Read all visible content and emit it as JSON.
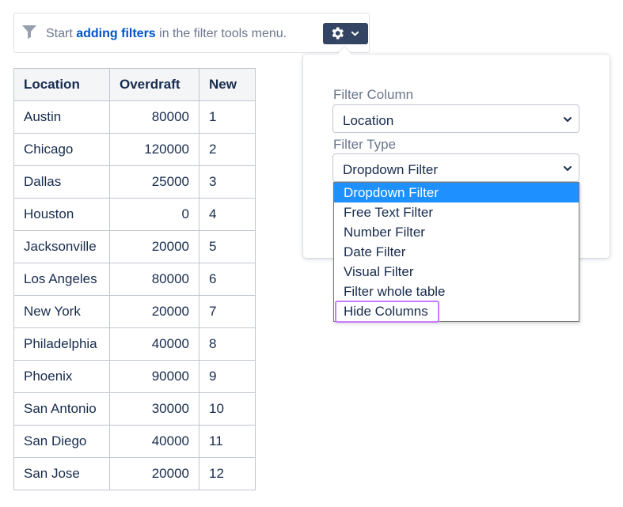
{
  "hint": {
    "prefix": "Start ",
    "link": "adding filters",
    "suffix": " in the filter tools menu.",
    "funnel_icon": "funnel-icon",
    "gear_icon": "gear-icon",
    "chevron_icon": "chevron-down-icon"
  },
  "table": {
    "headers": [
      "Location",
      "Overdraft",
      "New"
    ],
    "rows": [
      [
        "Austin",
        "80000",
        "1"
      ],
      [
        "Chicago",
        "120000",
        "2"
      ],
      [
        "Dallas",
        "25000",
        "3"
      ],
      [
        "Houston",
        "0",
        "4"
      ],
      [
        "Jacksonville",
        "20000",
        "5"
      ],
      [
        "Los Angeles",
        "80000",
        "6"
      ],
      [
        "New York",
        "20000",
        "7"
      ],
      [
        "Philadelphia",
        "40000",
        "8"
      ],
      [
        "Phoenix",
        "90000",
        "9"
      ],
      [
        "San Antonio",
        "30000",
        "10"
      ],
      [
        "San Diego",
        "40000",
        "11"
      ],
      [
        "San Jose",
        "20000",
        "12"
      ]
    ]
  },
  "panel": {
    "filter_column_label": "Filter Column",
    "filter_column_value": "Location",
    "filter_type_label": "Filter Type",
    "filter_type_value": "Dropdown Filter",
    "options": [
      "Dropdown Filter",
      "Free Text Filter",
      "Number Filter",
      "Date Filter",
      "Visual Filter",
      "Filter whole table",
      "Hide Columns"
    ],
    "selected_index": 0,
    "highlighted_option": "Hide Columns"
  },
  "colors": {
    "accent": "#0052cc",
    "gear_button": "#344563",
    "selected_option": "#1e90ff",
    "highlight_outline": "#c77dff"
  }
}
